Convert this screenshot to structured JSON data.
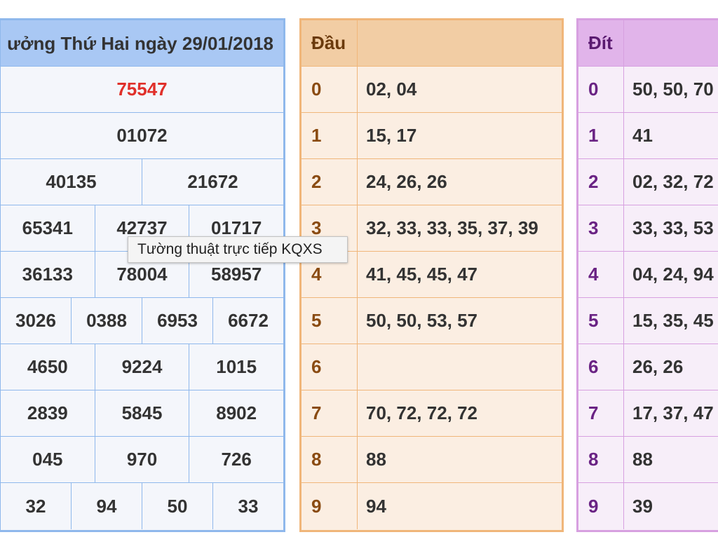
{
  "results": {
    "title": "ưởng Thứ Hai ngày 29/01/2018",
    "special": "75547",
    "rows": [
      [
        "01072"
      ],
      [
        "40135",
        "21672"
      ],
      [
        "65341",
        "42737",
        "01717"
      ],
      [
        "36133",
        "78004",
        "58957"
      ],
      [
        "3026",
        "0388",
        "6953",
        "6672"
      ],
      [
        "4650",
        "9224",
        "1015"
      ],
      [
        "2839",
        "5845",
        "8902"
      ],
      [
        "045",
        "970",
        "726"
      ],
      [
        "32",
        "94",
        "50",
        "33"
      ]
    ]
  },
  "dau": {
    "header": "Đầu",
    "rows": [
      {
        "k": "0",
        "v": "02, 04"
      },
      {
        "k": "1",
        "v": "15, 17"
      },
      {
        "k": "2",
        "v": "24, 26, 26"
      },
      {
        "k": "3",
        "v": "32, 33, 33, 35, 37, 39"
      },
      {
        "k": "4",
        "v": "41, 45, 45, 47"
      },
      {
        "k": "5",
        "v": "50, 50, 53, 57"
      },
      {
        "k": "6",
        "v": ""
      },
      {
        "k": "7",
        "v": "70, 72, 72, 72"
      },
      {
        "k": "8",
        "v": "88"
      },
      {
        "k": "9",
        "v": "94"
      }
    ]
  },
  "dit": {
    "header": "Đít",
    "rows": [
      {
        "k": "0",
        "v": "50, 50, 70"
      },
      {
        "k": "1",
        "v": "41"
      },
      {
        "k": "2",
        "v": "02, 32, 72"
      },
      {
        "k": "3",
        "v": "33, 33, 53"
      },
      {
        "k": "4",
        "v": "04, 24, 94"
      },
      {
        "k": "5",
        "v": "15, 35, 45"
      },
      {
        "k": "6",
        "v": "26, 26"
      },
      {
        "k": "7",
        "v": "17, 37, 47"
      },
      {
        "k": "8",
        "v": "88"
      },
      {
        "k": "9",
        "v": "39"
      }
    ]
  },
  "tooltip": "Tường thuật trực tiếp KQXS",
  "colors": {
    "special_number": "#e0302a",
    "results_accent": "#8fb8ec",
    "dau_accent": "#f0b67a",
    "dit_accent": "#d7a0e0"
  }
}
